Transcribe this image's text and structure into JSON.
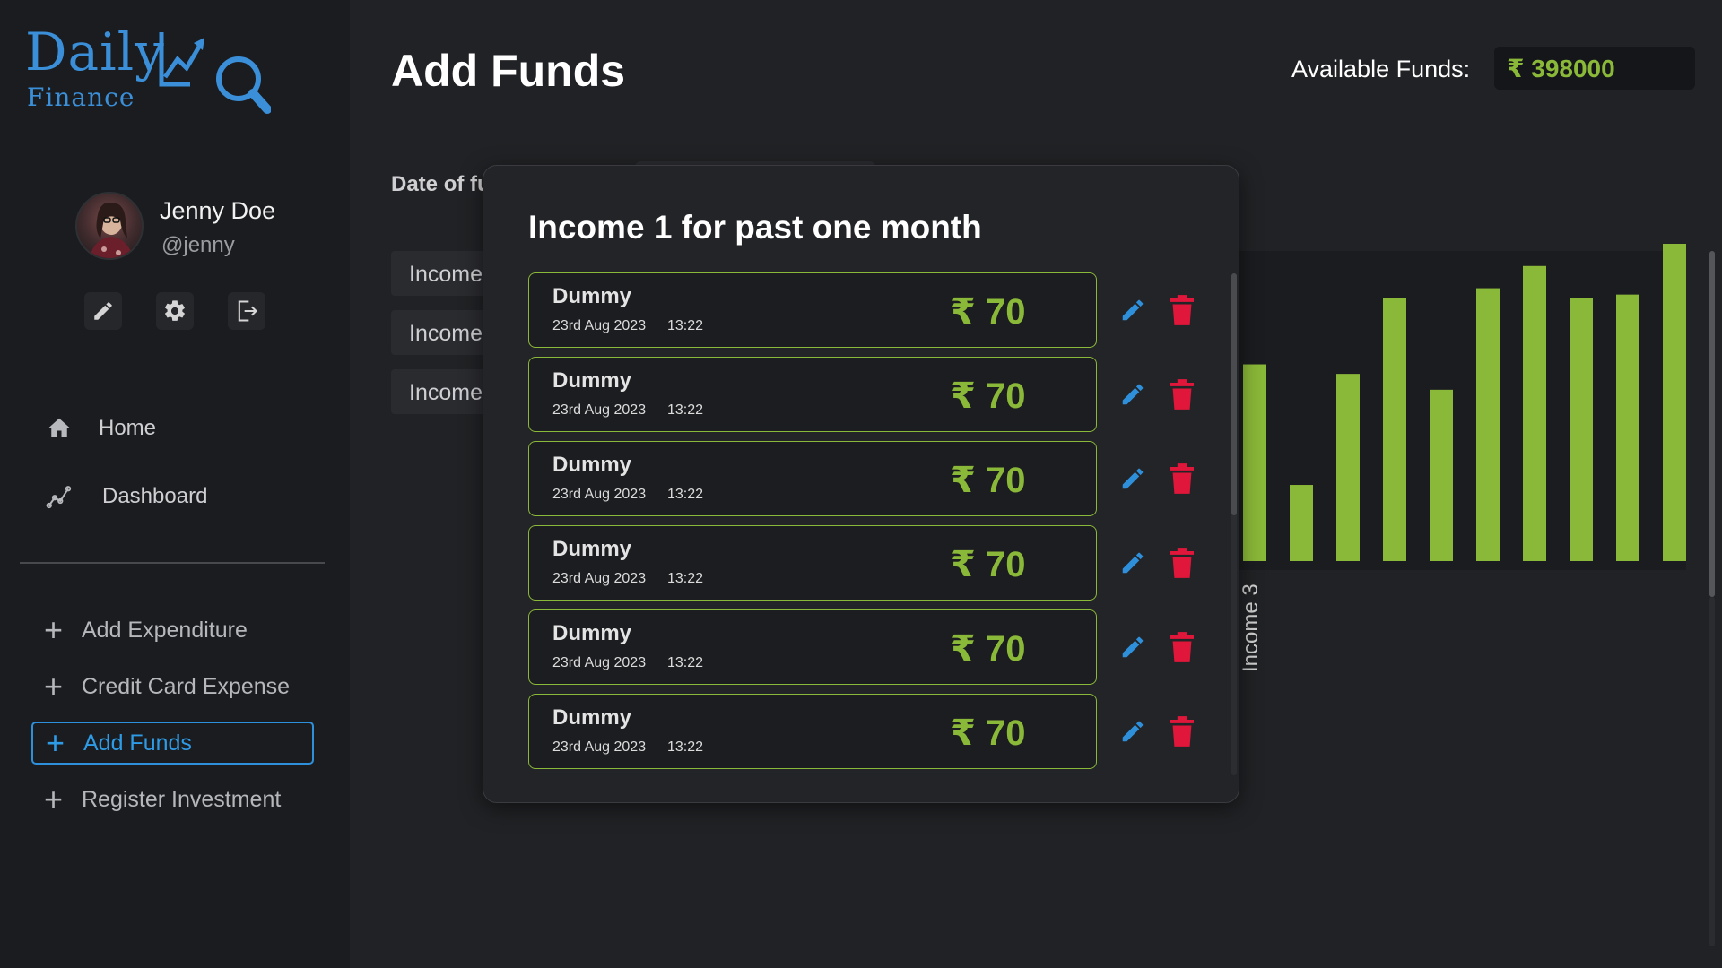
{
  "app": {
    "logo_main": "Daily",
    "logo_sub": "Finance",
    "logo_icon": "chart-magnifier-icon",
    "accent_color": "#2e8fdb",
    "positive_color": "#8ab838",
    "danger_color": "#e0163a"
  },
  "user": {
    "name": "Jenny Doe",
    "handle": "@jenny"
  },
  "user_actions": [
    {
      "icon": "pencil-icon"
    },
    {
      "icon": "gear-icon"
    },
    {
      "icon": "logout-icon"
    }
  ],
  "nav": {
    "home": "Home",
    "dashboard": "Dashboard"
  },
  "side_actions": {
    "add_expenditure": "Add Expenditure",
    "credit_card_expense": "Credit Card Expense",
    "add_funds": "Add Funds",
    "register_investment": "Register Investment",
    "active": "Add Funds"
  },
  "header": {
    "title": "Add Funds",
    "available_label": "Available Funds:",
    "available_value": "₹ 398000"
  },
  "form": {
    "date_label": "Date of fu"
  },
  "income_tabs": [
    "Income",
    "Income",
    "Income"
  ],
  "modal": {
    "title": "Income 1 for past one month",
    "entries": [
      {
        "name": "Dummy",
        "date": "23rd Aug 2023",
        "time": "13:22",
        "amount": "₹ 70"
      },
      {
        "name": "Dummy",
        "date": "23rd Aug 2023",
        "time": "13:22",
        "amount": "₹ 70"
      },
      {
        "name": "Dummy",
        "date": "23rd Aug 2023",
        "time": "13:22",
        "amount": "₹ 70"
      },
      {
        "name": "Dummy",
        "date": "23rd Aug 2023",
        "time": "13:22",
        "amount": "₹ 70"
      },
      {
        "name": "Dummy",
        "date": "23rd Aug 2023",
        "time": "13:22",
        "amount": "₹ 70"
      },
      {
        "name": "Dummy",
        "date": "23rd Aug 2023",
        "time": "13:22",
        "amount": "₹ 70"
      }
    ]
  },
  "chart_data": {
    "type": "bar",
    "visible_category_label": "Income 3",
    "values": [
      0.62,
      0.24,
      0.59,
      0.83,
      0.54,
      0.86,
      0.93,
      0.83,
      0.84,
      1.0
    ],
    "note_units": "relative bar heights (axis not visible)",
    "bar_color": "#8ab838"
  }
}
